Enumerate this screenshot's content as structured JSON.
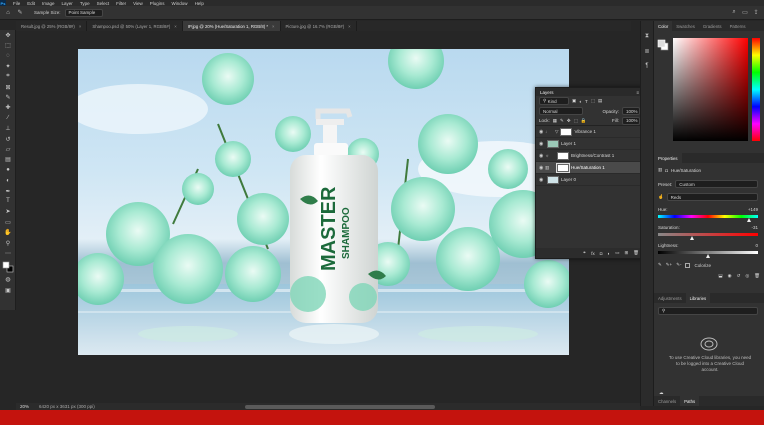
{
  "menubar": {
    "items": [
      "File",
      "Edit",
      "Image",
      "Layer",
      "Type",
      "Select",
      "Filter",
      "View",
      "Plugins",
      "Window",
      "Help"
    ],
    "logo": "Ps"
  },
  "options": {
    "sample_size_label": "Sample Size:",
    "sample_size_value": "Point Sample"
  },
  "tabs": [
    {
      "label": "Result.jpg @ 25% (RGB/8#)",
      "active": false
    },
    {
      "label": "Shampoo.psd @ 50% (Layer 1, RGB/8#)",
      "active": false
    },
    {
      "label": "IP.jpg @ 20% (Hue/Saturation 1, RGB/8) *",
      "active": true
    },
    {
      "label": "Picture.jpg @ 16.7% (RGB/8#)",
      "active": false
    }
  ],
  "bottle": {
    "brand": "MASTER",
    "product": "SHAMPOO"
  },
  "layers_panel": {
    "title": "Layers",
    "filter": "Kind",
    "blend_mode": "Normal",
    "opacity_label": "Opacity:",
    "opacity_value": "100%",
    "lock_label": "Lock:",
    "fill_label": "Fill:",
    "fill_value": "100%",
    "layers": [
      {
        "name": "Vibrance 1",
        "selected": false
      },
      {
        "name": "Layer 1",
        "selected": false
      },
      {
        "name": "Brightness/Contrast 1",
        "selected": false
      },
      {
        "name": "Hue/Saturation 1",
        "selected": true
      },
      {
        "name": "Layer 0",
        "selected": false
      }
    ]
  },
  "color_panel": {
    "tabs": [
      "Color",
      "Swatches",
      "Gradients",
      "Patterns"
    ],
    "hue_color": "#ff0000"
  },
  "properties_panel": {
    "title": "Properties",
    "subtitle": "Hue/Saturation",
    "preset_label": "Preset:",
    "preset_value": "Custom",
    "channel_value": "Reds",
    "hue_label": "Hue:",
    "hue_value": "+149",
    "hue_level": 0.91,
    "saturation_label": "Saturation:",
    "saturation_value": "-31",
    "saturation_level": 0.345,
    "lightness_label": "Lightness:",
    "lightness_value": "0",
    "lightness_level": 0.5,
    "colorize_label": "Colorize"
  },
  "libraries_panel": {
    "tabs": [
      "Adjustments",
      "Libraries"
    ],
    "message": "To use Creative Cloud libraries, you need to be logged into a Creative Cloud account."
  },
  "bottom_tabs": [
    "Channels",
    "Paths"
  ],
  "status": {
    "zoom": "20%",
    "doc_info": "6420 px x 3631 px (300 ppi)"
  },
  "colors": {
    "accent": "#31a8ff",
    "red_bar": "#c4130d"
  }
}
